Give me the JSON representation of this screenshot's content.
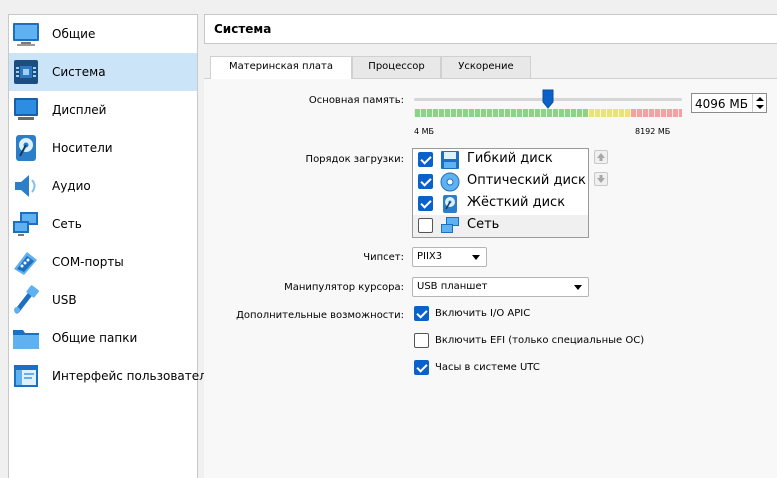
{
  "sidebar": {
    "items": [
      {
        "label": "Общие",
        "icon": "general-icon"
      },
      {
        "label": "Система",
        "icon": "system-icon",
        "selected": true
      },
      {
        "label": "Дисплей",
        "icon": "display-icon"
      },
      {
        "label": "Носители",
        "icon": "storage-icon"
      },
      {
        "label": "Аудио",
        "icon": "audio-icon"
      },
      {
        "label": "Сеть",
        "icon": "network-icon"
      },
      {
        "label": "COM-порты",
        "icon": "serial-port-icon"
      },
      {
        "label": "USB",
        "icon": "usb-icon"
      },
      {
        "label": "Общие папки",
        "icon": "shared-folder-icon"
      },
      {
        "label": "Интерфейс пользователя",
        "icon": "user-interface-icon"
      }
    ]
  },
  "header": {
    "title": "Система"
  },
  "tabs": [
    {
      "label": "Материнская плата",
      "active": true
    },
    {
      "label": "Процессор",
      "active": false
    },
    {
      "label": "Ускорение",
      "active": false
    }
  ],
  "motherboard": {
    "memory_label": "Основная память:",
    "memory_value": "4096 МБ",
    "memory_min_label": "4 МБ",
    "memory_max_label": "8192 МБ",
    "memory_fraction": 0.5,
    "boot_order_label": "Порядок загрузки:",
    "boot_items": [
      {
        "label": "Гибкий диск",
        "checked": true,
        "icon": "floppy-icon"
      },
      {
        "label": "Оптический диск",
        "checked": true,
        "icon": "optical-disk-icon"
      },
      {
        "label": "Жёсткий диск",
        "checked": true,
        "icon": "hard-disk-icon"
      },
      {
        "label": "Сеть",
        "checked": false,
        "icon": "network-icon"
      }
    ],
    "chipset_label": "Чипсет:",
    "chipset_value": "PIIX3",
    "pointing_label": "Манипулятор курсора:",
    "pointing_value": "USB планшет",
    "extended_label": "Дополнительные возможности:",
    "extended_options": [
      {
        "label": "Включить I/O APIC",
        "checked": true
      },
      {
        "label": "Включить EFI (только специальные ОС)",
        "checked": false
      },
      {
        "label": "Часы в системе UTC",
        "checked": true
      }
    ]
  },
  "colors": {
    "selection": "#cce4f7",
    "checkbox_accent": "#0a61c9",
    "scale_green": "#8fd18a",
    "scale_yellow": "#e9e37b",
    "scale_red": "#f1a3a3"
  }
}
